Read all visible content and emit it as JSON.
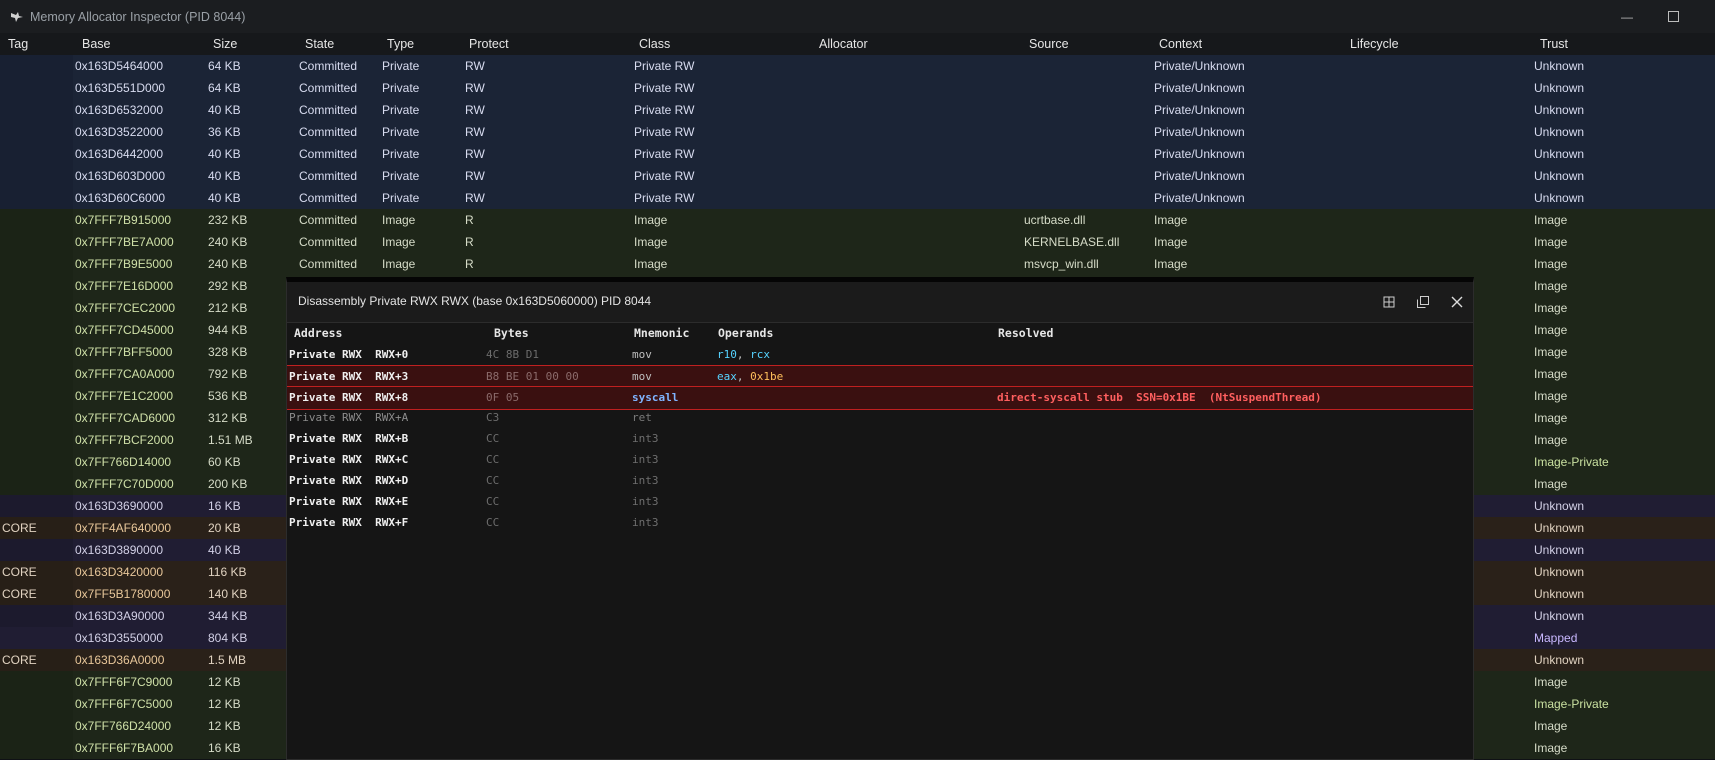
{
  "window": {
    "title": "Memory Allocator Inspector (PID 8044)"
  },
  "columns": [
    "Tag",
    "Base",
    "Size",
    "State",
    "Type",
    "Protect",
    "Class",
    "Allocator",
    "Source",
    "Context",
    "Lifecycle",
    "Trust"
  ],
  "rows": [
    {
      "kind": "priv",
      "tag": "",
      "base": "0x163D5464000",
      "size": "64 KB",
      "state": "Committed",
      "type": "Private",
      "protect": "RW",
      "cls": "Private RW",
      "allocator": "",
      "source": "",
      "context": "Private/Unknown",
      "lifecycle": "",
      "trust": "Unknown"
    },
    {
      "kind": "priv",
      "tag": "",
      "base": "0x163D551D000",
      "size": "64 KB",
      "state": "Committed",
      "type": "Private",
      "protect": "RW",
      "cls": "Private RW",
      "allocator": "",
      "source": "",
      "context": "Private/Unknown",
      "lifecycle": "",
      "trust": "Unknown"
    },
    {
      "kind": "priv",
      "tag": "",
      "base": "0x163D6532000",
      "size": "40 KB",
      "state": "Committed",
      "type": "Private",
      "protect": "RW",
      "cls": "Private RW",
      "allocator": "",
      "source": "",
      "context": "Private/Unknown",
      "lifecycle": "",
      "trust": "Unknown"
    },
    {
      "kind": "priv",
      "tag": "",
      "base": "0x163D3522000",
      "size": "36 KB",
      "state": "Committed",
      "type": "Private",
      "protect": "RW",
      "cls": "Private RW",
      "allocator": "",
      "source": "",
      "context": "Private/Unknown",
      "lifecycle": "",
      "trust": "Unknown"
    },
    {
      "kind": "priv",
      "tag": "",
      "base": "0x163D6442000",
      "size": "40 KB",
      "state": "Committed",
      "type": "Private",
      "protect": "RW",
      "cls": "Private RW",
      "allocator": "",
      "source": "",
      "context": "Private/Unknown",
      "lifecycle": "",
      "trust": "Unknown"
    },
    {
      "kind": "priv",
      "tag": "",
      "base": "0x163D603D000",
      "size": "40 KB",
      "state": "Committed",
      "type": "Private",
      "protect": "RW",
      "cls": "Private RW",
      "allocator": "",
      "source": "",
      "context": "Private/Unknown",
      "lifecycle": "",
      "trust": "Unknown"
    },
    {
      "kind": "priv",
      "tag": "",
      "base": "0x163D60C6000",
      "size": "40 KB",
      "state": "Committed",
      "type": "Private",
      "protect": "RW",
      "cls": "Private RW",
      "allocator": "",
      "source": "",
      "context": "Private/Unknown",
      "lifecycle": "",
      "trust": "Unknown"
    },
    {
      "kind": "image",
      "tag": "",
      "base": "0x7FFF7B915000",
      "size": "232 KB",
      "state": "Committed",
      "type": "Image",
      "protect": "R",
      "cls": "Image",
      "allocator": "",
      "source": "ucrtbase.dll",
      "context": "Image",
      "lifecycle": "",
      "trust": "Image"
    },
    {
      "kind": "image",
      "tag": "",
      "base": "0x7FFF7BE7A000",
      "size": "240 KB",
      "state": "Committed",
      "type": "Image",
      "protect": "R",
      "cls": "Image",
      "allocator": "",
      "source": "KERNELBASE.dll",
      "context": "Image",
      "lifecycle": "",
      "trust": "Image"
    },
    {
      "kind": "image",
      "tag": "",
      "base": "0x7FFF7B9E5000",
      "size": "240 KB",
      "state": "Committed",
      "type": "Image",
      "protect": "R",
      "cls": "Image",
      "allocator": "",
      "source": "msvcp_win.dll",
      "context": "Image",
      "lifecycle": "",
      "trust": "Image"
    },
    {
      "kind": "image",
      "tag": "",
      "base": "0x7FFF7E16D000",
      "size": "292 KB",
      "state": "",
      "type": "",
      "protect": "",
      "cls": "",
      "allocator": "",
      "source": "",
      "context": "",
      "lifecycle": "",
      "trust": "Image"
    },
    {
      "kind": "image",
      "tag": "",
      "base": "0x7FFF7CEC2000",
      "size": "212 KB",
      "state": "",
      "type": "",
      "protect": "",
      "cls": "",
      "allocator": "",
      "source": "",
      "context": "",
      "lifecycle": "",
      "trust": "Image"
    },
    {
      "kind": "image",
      "tag": "",
      "base": "0x7FFF7CD45000",
      "size": "944 KB",
      "state": "",
      "type": "",
      "protect": "",
      "cls": "",
      "allocator": "",
      "source": "",
      "context": "",
      "lifecycle": "",
      "trust": "Image"
    },
    {
      "kind": "image",
      "tag": "",
      "base": "0x7FFF7BFF5000",
      "size": "328 KB",
      "state": "",
      "type": "",
      "protect": "",
      "cls": "",
      "allocator": "",
      "source": "",
      "context": "",
      "lifecycle": "",
      "trust": "Image"
    },
    {
      "kind": "image",
      "tag": "",
      "base": "0x7FFF7CA0A000",
      "size": "792 KB",
      "state": "",
      "type": "",
      "protect": "",
      "cls": "",
      "allocator": "",
      "source": "",
      "context": "",
      "lifecycle": "",
      "trust": "Image"
    },
    {
      "kind": "image",
      "tag": "",
      "base": "0x7FFF7E1C2000",
      "size": "536 KB",
      "state": "",
      "type": "",
      "protect": "",
      "cls": "",
      "allocator": "",
      "source": "",
      "context": "",
      "lifecycle": "",
      "trust": "Image"
    },
    {
      "kind": "image",
      "tag": "",
      "base": "0x7FFF7CAD6000",
      "size": "312 KB",
      "state": "",
      "type": "",
      "protect": "",
      "cls": "",
      "allocator": "",
      "source": "",
      "context": "",
      "lifecycle": "",
      "trust": "Image"
    },
    {
      "kind": "image",
      "tag": "",
      "base": "0x7FFF7BCF2000",
      "size": "1.51 MB",
      "state": "",
      "type": "",
      "protect": "",
      "cls": "",
      "allocator": "",
      "source": "",
      "context": "",
      "lifecycle": "",
      "trust": "Image"
    },
    {
      "kind": "image imagep",
      "tag": "",
      "base": "0x7FF766D14000",
      "size": "60 KB",
      "state": "",
      "type": "",
      "protect": "",
      "cls": "",
      "allocator": "",
      "source": "",
      "context": "",
      "lifecycle": "",
      "trust": "Image-Private"
    },
    {
      "kind": "image",
      "tag": "",
      "base": "0x7FFF7C70D000",
      "size": "200 KB",
      "state": "",
      "type": "",
      "protect": "",
      "cls": "",
      "allocator": "",
      "source": "",
      "context": "",
      "lifecycle": "",
      "trust": "Image"
    },
    {
      "kind": "unknown",
      "tag": "",
      "base": "0x163D3690000",
      "size": "16 KB",
      "state": "",
      "type": "",
      "protect": "",
      "cls": "",
      "allocator": "",
      "source": "",
      "context": "",
      "lifecycle": "",
      "trust": "Unknown"
    },
    {
      "kind": "core",
      "tag": "CORE",
      "base": "0x7FF4AF640000",
      "size": "20 KB",
      "state": "",
      "type": "",
      "protect": "",
      "cls": "",
      "allocator": "",
      "source": "",
      "context": "",
      "lifecycle": "",
      "trust": "Unknown"
    },
    {
      "kind": "unknown",
      "tag": "",
      "base": "0x163D3890000",
      "size": "40 KB",
      "state": "",
      "type": "",
      "protect": "",
      "cls": "",
      "allocator": "",
      "source": "",
      "context": "",
      "lifecycle": "",
      "trust": "Unknown"
    },
    {
      "kind": "core",
      "tag": "CORE",
      "base": "0x163D3420000",
      "size": "116 KB",
      "state": "",
      "type": "",
      "protect": "",
      "cls": "",
      "allocator": "",
      "source": "",
      "context": "",
      "lifecycle": "",
      "trust": "Unknown"
    },
    {
      "kind": "core",
      "tag": "CORE",
      "base": "0x7FF5B1780000",
      "size": "140 KB",
      "state": "",
      "type": "",
      "protect": "",
      "cls": "",
      "allocator": "",
      "source": "",
      "context": "",
      "lifecycle": "",
      "trust": "Unknown"
    },
    {
      "kind": "unknown",
      "tag": "",
      "base": "0x163D3A90000",
      "size": "344 KB",
      "state": "",
      "type": "",
      "protect": "",
      "cls": "",
      "allocator": "",
      "source": "",
      "context": "",
      "lifecycle": "",
      "trust": "Unknown"
    },
    {
      "kind": "mapped",
      "tag": "",
      "base": "0x163D3550000",
      "size": "804 KB",
      "state": "",
      "type": "",
      "protect": "",
      "cls": "",
      "allocator": "",
      "source": "",
      "context": "",
      "lifecycle": "",
      "trust": "Mapped"
    },
    {
      "kind": "core",
      "tag": "CORE",
      "base": "0x163D36A0000",
      "size": "1.5 MB",
      "state": "",
      "type": "",
      "protect": "",
      "cls": "",
      "allocator": "",
      "source": "",
      "context": "",
      "lifecycle": "",
      "trust": "Unknown"
    },
    {
      "kind": "image",
      "tag": "",
      "base": "0x7FFF6F7C9000",
      "size": "12 KB",
      "state": "",
      "type": "",
      "protect": "",
      "cls": "",
      "allocator": "",
      "source": "",
      "context": "",
      "lifecycle": "",
      "trust": "Image"
    },
    {
      "kind": "image imagep",
      "tag": "",
      "base": "0x7FFF6F7C5000",
      "size": "12 KB",
      "state": "",
      "type": "",
      "protect": "",
      "cls": "",
      "allocator": "",
      "source": "",
      "context": "",
      "lifecycle": "",
      "trust": "Image-Private"
    },
    {
      "kind": "image",
      "tag": "",
      "base": "0x7FF766D24000",
      "size": "12 KB",
      "state": "",
      "type": "",
      "protect": "",
      "cls": "",
      "allocator": "",
      "source": "",
      "context": "",
      "lifecycle": "",
      "trust": "Image"
    },
    {
      "kind": "image",
      "tag": "",
      "base": "0x7FFF6F7BA000",
      "size": "16 KB",
      "state": "",
      "type": "",
      "protect": "",
      "cls": "",
      "allocator": "",
      "source": "",
      "context": "",
      "lifecycle": "",
      "trust": "Image"
    }
  ],
  "disasm": {
    "title": "Disassembly  Private RWX  RWX  (base 0x163D5060000)  PID 8044",
    "headers": {
      "address": "Address",
      "bytes": "Bytes",
      "mnemonic": "Mnemonic",
      "operands": "Operands",
      "resolved": "Resolved"
    },
    "rows": [
      {
        "cls": "",
        "addr": "Private RWX  RWX+0",
        "bytes": "4C 8B D1",
        "mnem": "mov",
        "op1": "r10",
        "op1cls": "reg",
        "op2": "rcx",
        "op2cls": "reg",
        "resolved": ""
      },
      {
        "cls": "hl",
        "addr": "Private RWX  RWX+3",
        "bytes": "B8 BE 01 00 00",
        "mnem": "mov",
        "op1": "eax",
        "op1cls": "reg",
        "op2": "0x1be",
        "op2cls": "imm",
        "resolved": ""
      },
      {
        "cls": "hl",
        "addr": "Private RWX  RWX+8",
        "bytes": "0F 05",
        "mnem": "syscall",
        "mnemcls": "sys",
        "op1": "",
        "op2": "",
        "resolved": "direct-syscall stub  SSN=0x1BE  (NtSuspendThread)"
      },
      {
        "cls": "dim",
        "addr": "Private RWX  RWX+A",
        "bytes": "C3",
        "mnem": "ret",
        "op1": "",
        "op2": "",
        "resolved": ""
      },
      {
        "cls": "",
        "addr": "Private RWX  RWX+B",
        "bytes": "CC",
        "mnem": "int3",
        "mnemcls": "dimm",
        "op1": "",
        "op2": "",
        "resolved": ""
      },
      {
        "cls": "",
        "addr": "Private RWX  RWX+C",
        "bytes": "CC",
        "mnem": "int3",
        "mnemcls": "dimm",
        "op1": "",
        "op2": "",
        "resolved": ""
      },
      {
        "cls": "",
        "addr": "Private RWX  RWX+D",
        "bytes": "CC",
        "mnem": "int3",
        "mnemcls": "dimm",
        "op1": "",
        "op2": "",
        "resolved": ""
      },
      {
        "cls": "",
        "addr": "Private RWX  RWX+E",
        "bytes": "CC",
        "mnem": "int3",
        "mnemcls": "dimm",
        "op1": "",
        "op2": "",
        "resolved": ""
      },
      {
        "cls": "",
        "addr": "Private RWX  RWX+F",
        "bytes": "CC",
        "mnem": "int3",
        "mnemcls": "dimm",
        "op1": "",
        "op2": "",
        "resolved": ""
      }
    ]
  }
}
